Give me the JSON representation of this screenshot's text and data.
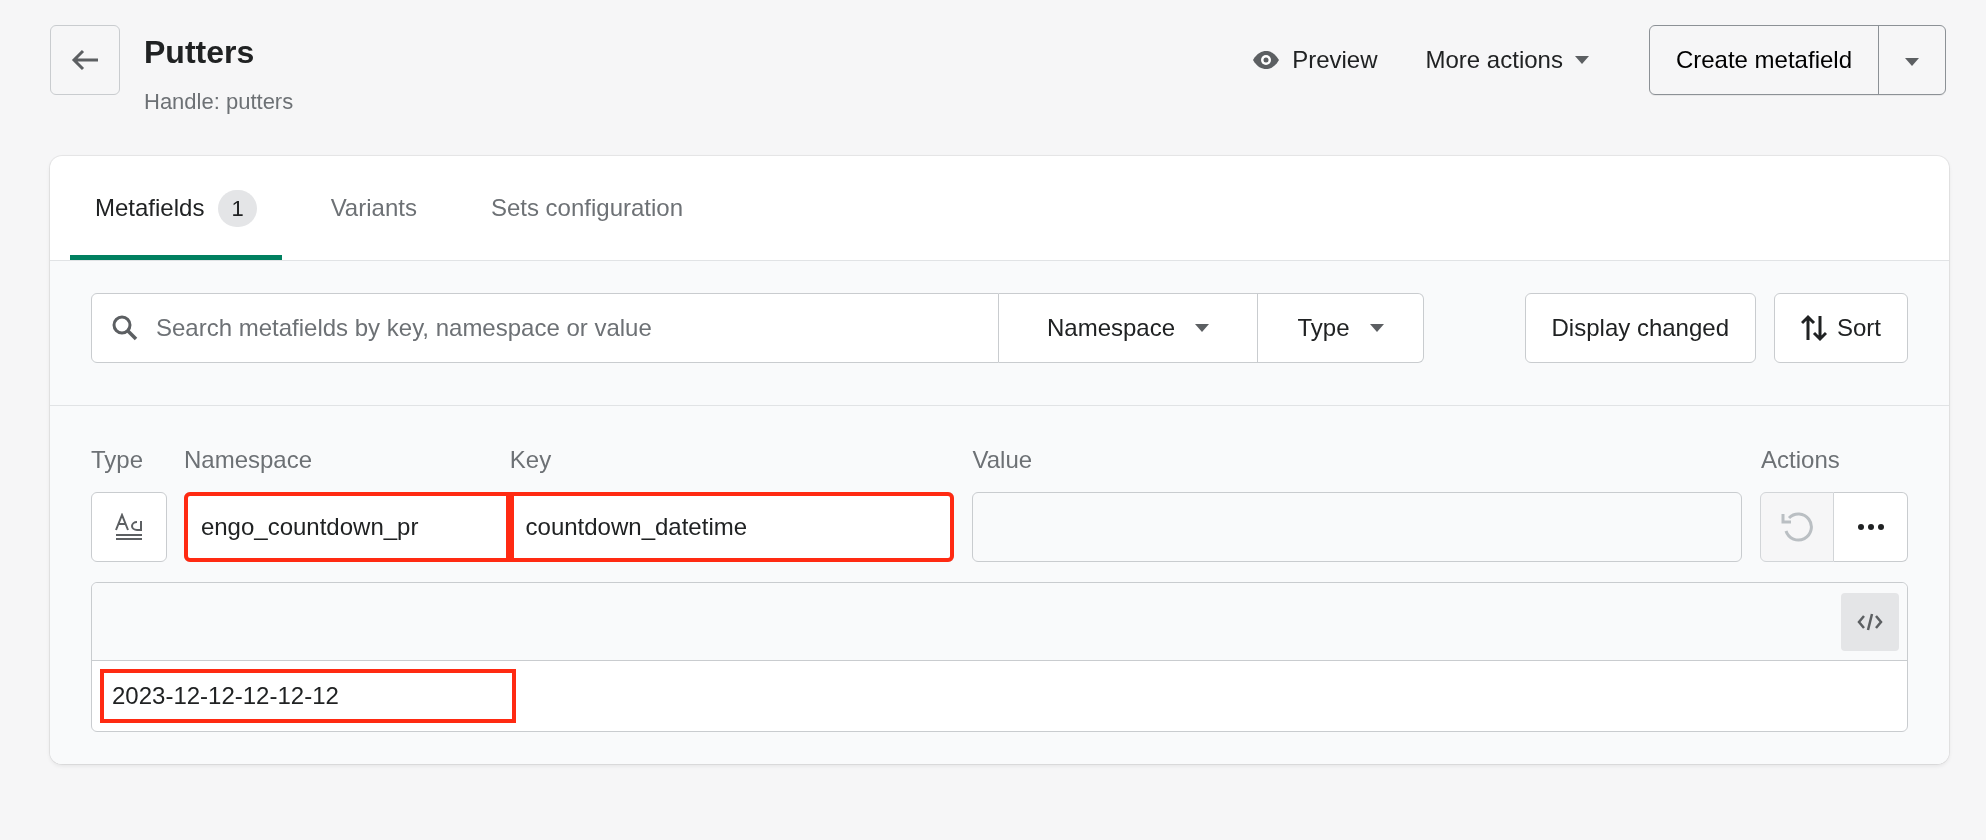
{
  "header": {
    "title": "Putters",
    "subtitle": "Handle: putters",
    "actions": [
      {
        "kind": "preview",
        "label": "Preview"
      },
      {
        "kind": "dropdown",
        "label": "More actions"
      }
    ],
    "primary_button": "Create metafield"
  },
  "tabs": [
    {
      "label": "Metafields",
      "count": "1",
      "selected": true
    },
    {
      "label": "Variants",
      "selected": false
    },
    {
      "label": "Sets configuration",
      "selected": false
    }
  ],
  "filters": {
    "search_placeholder": "Search metafields by key, namespace or value",
    "dropdowns": [
      "Namespace",
      "Type"
    ],
    "buttons": [
      {
        "kind": "plain",
        "label": "Display changed"
      },
      {
        "kind": "sort",
        "label": "Sort"
      }
    ]
  },
  "columns": [
    "Type",
    "Namespace",
    "Key",
    "Value",
    "Actions"
  ],
  "row": {
    "namespace": {
      "value": "engo_countdown_pr",
      "highlighted": true
    },
    "key": {
      "value": "countdown_datetime",
      "highlighted": true
    },
    "undo_disabled": true,
    "editor": {
      "value": "2023-12-12-12-12-12",
      "highlighted": true
    }
  }
}
